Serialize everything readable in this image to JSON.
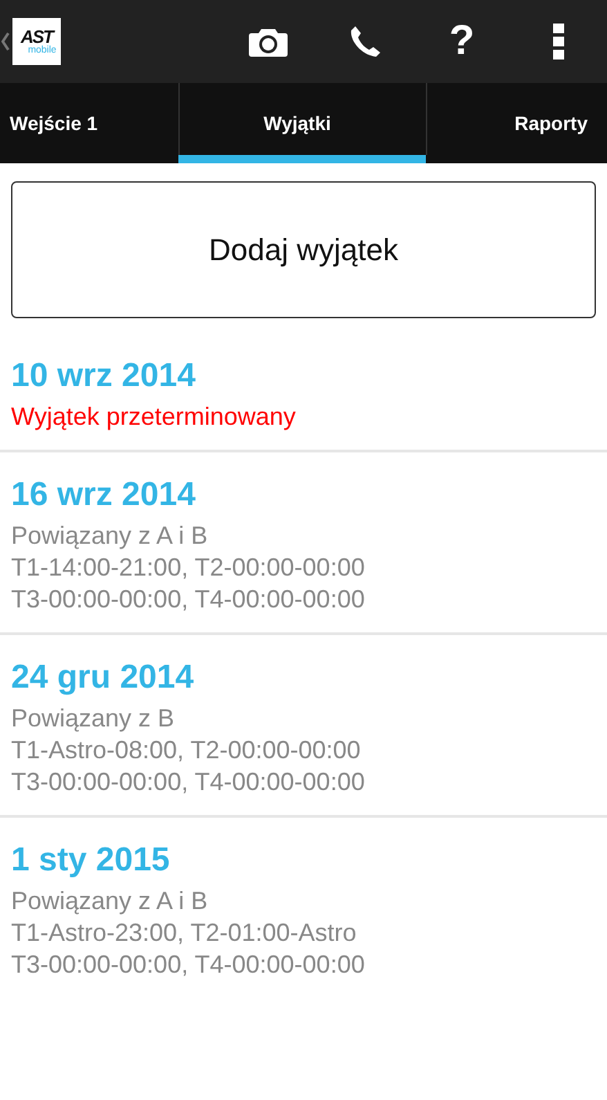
{
  "action_bar": {
    "logo": {
      "title": "AST",
      "subtitle": "mobile"
    },
    "actions": [
      {
        "kind": "camera"
      },
      {
        "kind": "phone"
      },
      {
        "kind": "help",
        "glyph": "?"
      },
      {
        "kind": "overflow"
      }
    ]
  },
  "tabs": [
    {
      "label": "Wejście 1",
      "selected": false
    },
    {
      "label": "Wyjątki",
      "selected": true
    },
    {
      "label": "Raporty",
      "selected": false
    }
  ],
  "add_button": "Dodaj wyjątek",
  "exceptions": [
    {
      "date": "10 wrz 2014",
      "lines": [
        {
          "kind": "warning",
          "text": "Wyjątek przeterminowany"
        }
      ]
    },
    {
      "date": "16 wrz 2014",
      "lines": [
        {
          "kind": "info",
          "text": "Powiązany z A i B"
        },
        {
          "kind": "info",
          "text": "T1-14:00-21:00, T2-00:00-00:00"
        },
        {
          "kind": "info",
          "text": "T3-00:00-00:00, T4-00:00-00:00"
        }
      ]
    },
    {
      "date": "24 gru 2014",
      "lines": [
        {
          "kind": "info",
          "text": "Powiązany z B"
        },
        {
          "kind": "info",
          "text": "T1-Astro-08:00, T2-00:00-00:00"
        },
        {
          "kind": "info",
          "text": "T3-00:00-00:00, T4-00:00-00:00"
        }
      ]
    },
    {
      "date": "1 sty 2015",
      "lines": [
        {
          "kind": "info",
          "text": "Powiązany z A i B"
        },
        {
          "kind": "info",
          "text": "T1-Astro-23:00, T2-01:00-Astro"
        },
        {
          "kind": "info",
          "text": "T3-00:00-00:00, T4-00:00-00:00"
        }
      ]
    }
  ]
}
